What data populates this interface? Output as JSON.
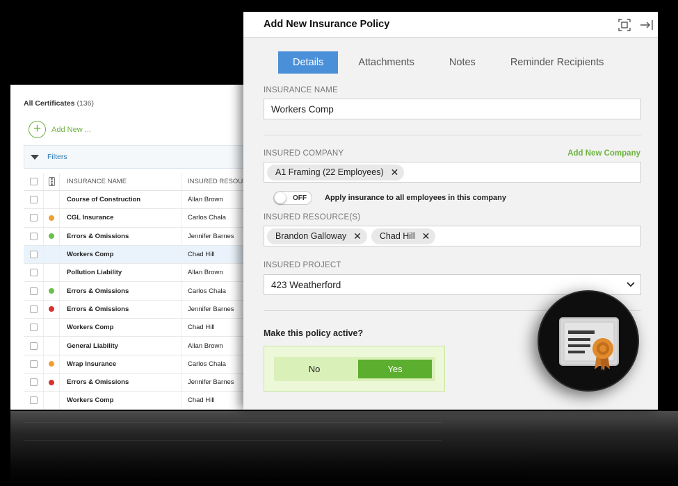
{
  "certificates": {
    "title": "All Certificates",
    "count": "(136)",
    "add_new": "Add New ...",
    "filters": "Filters",
    "columns": {
      "name": "INSURANCE NAME",
      "resource": "INSURED RESOUR"
    },
    "rows": [
      {
        "name": "Course of Construction",
        "resource": "Allan Brown",
        "status": ""
      },
      {
        "name": "CGL Insurance",
        "resource": "Carlos Chala",
        "status": "#f0a030"
      },
      {
        "name": "Errors & Omissions",
        "resource": "Jennifer Barnes",
        "status": "#6cc04a"
      },
      {
        "name": "Workers Comp",
        "resource": "Chad Hill",
        "status": ""
      },
      {
        "name": "Pollution Liability",
        "resource": "Allan Brown",
        "status": ""
      },
      {
        "name": "Errors & Omissions",
        "resource": "Carlos Chala",
        "status": "#6cc04a"
      },
      {
        "name": "Errors & Omissions",
        "resource": "Jennifer Barnes",
        "status": "#d9302c"
      },
      {
        "name": "Workers Comp",
        "resource": "Chad Hill",
        "status": ""
      },
      {
        "name": "General Liability",
        "resource": "Allan Brown",
        "status": ""
      },
      {
        "name": "Wrap Insurance",
        "resource": "Carlos Chala",
        "status": "#f0a030"
      },
      {
        "name": "Errors & Omissions",
        "resource": "Jennifer Barnes",
        "status": "#d9302c"
      },
      {
        "name": "Workers Comp",
        "resource": "Chad Hill",
        "status": ""
      }
    ],
    "selected_row": 3
  },
  "dialog": {
    "title": "Add New Insurance Policy",
    "tabs": [
      "Details",
      "Attachments",
      "Notes",
      "Reminder Recipients"
    ],
    "active_tab": 0,
    "insurance_name_label": "INSURANCE NAME",
    "insurance_name_value": "Workers Comp",
    "insured_company_label": "INSURED COMPANY",
    "add_company_link": "Add New Company",
    "company_chip": "A1 Framing (22 Employees)",
    "toggle_state": "OFF",
    "toggle_label": "Apply insurance to all employees in this company",
    "insured_resources_label": "INSURED RESOURCE(S)",
    "resource_chips": [
      "Brandon Galloway",
      "Chad Hill"
    ],
    "insured_project_label": "INSURED PROJECT",
    "insured_project_value": "423 Weatherford",
    "active_question": "Make this policy active?",
    "option_no": "No",
    "option_yes": "Yes",
    "selected_option": "Yes"
  },
  "colors": {
    "accent_blue": "#4a90d9",
    "accent_green": "#5cae2e",
    "link_green": "#6db33f"
  },
  "icons": {
    "expand": "expand-icon",
    "collapse": "collapse-panel-icon",
    "badge": "certificate-ribbon-icon"
  }
}
